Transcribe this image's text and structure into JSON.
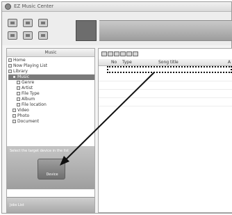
{
  "window": {
    "title": "EZ Music Center"
  },
  "sidebar": {
    "header": "Music",
    "tree": [
      {
        "label": "Home",
        "indent": 0
      },
      {
        "label": "Now Playing List",
        "indent": 0
      },
      {
        "label": "Library",
        "indent": 0
      },
      {
        "label": "Music",
        "indent": 1,
        "selected": true
      },
      {
        "label": "Genre",
        "indent": 2
      },
      {
        "label": "Artist",
        "indent": 2
      },
      {
        "label": "File Type",
        "indent": 2
      },
      {
        "label": "Album",
        "indent": 2
      },
      {
        "label": "File location",
        "indent": 2
      },
      {
        "label": "Video",
        "indent": 1
      },
      {
        "label": "Photo",
        "indent": 1
      },
      {
        "label": "Document",
        "indent": 1
      }
    ],
    "drop_caption": "Select the target device in the list",
    "device_label": "Device",
    "footer_label": "Jobs List"
  },
  "content": {
    "columns": {
      "no": "No",
      "type": "Type",
      "song": "Song title",
      "extra": "A"
    }
  }
}
